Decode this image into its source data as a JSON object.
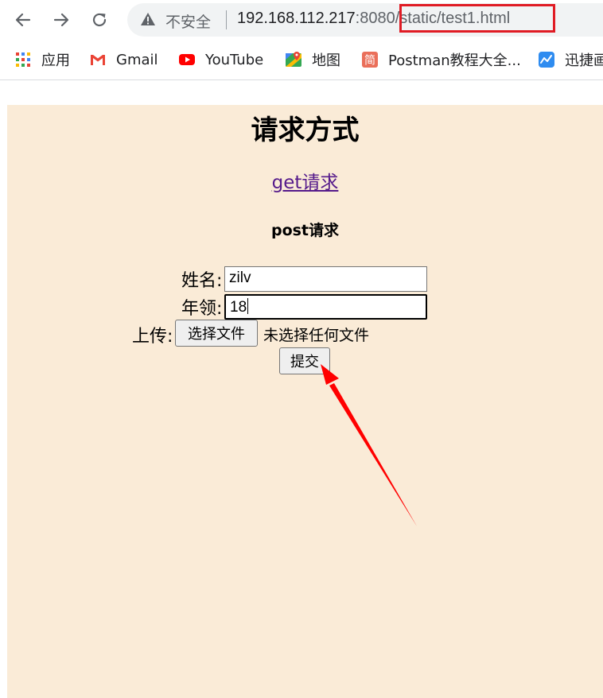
{
  "browser": {
    "security_label": "不安全",
    "url_host": "192.168.112.217",
    "url_port": ":8080",
    "url_path": "/static/test1.html"
  },
  "bookmarks": [
    {
      "label": "应用",
      "icon": "apps-grid-icon"
    },
    {
      "label": "Gmail",
      "icon": "gmail-icon"
    },
    {
      "label": "YouTube",
      "icon": "youtube-icon"
    },
    {
      "label": "地图",
      "icon": "maps-icon"
    },
    {
      "label": "Postman教程大全...",
      "icon": "jian-icon"
    },
    {
      "label": "迅捷画",
      "icon": "xunjie-icon"
    }
  ],
  "page": {
    "title": "请求方式",
    "get_link": "get请求",
    "post_heading": "post请求",
    "name_label": "姓名:",
    "name_value": "zilv",
    "age_label": "年领:",
    "age_value": "18",
    "upload_label": "上传:",
    "choose_file_button": "选择文件",
    "no_file_text": "未选择任何文件",
    "submit_button": "提交",
    "background_color": "#faebd7"
  },
  "annotations": {
    "highlight_color": "#e01b24",
    "arrow_color": "#ff0000"
  }
}
